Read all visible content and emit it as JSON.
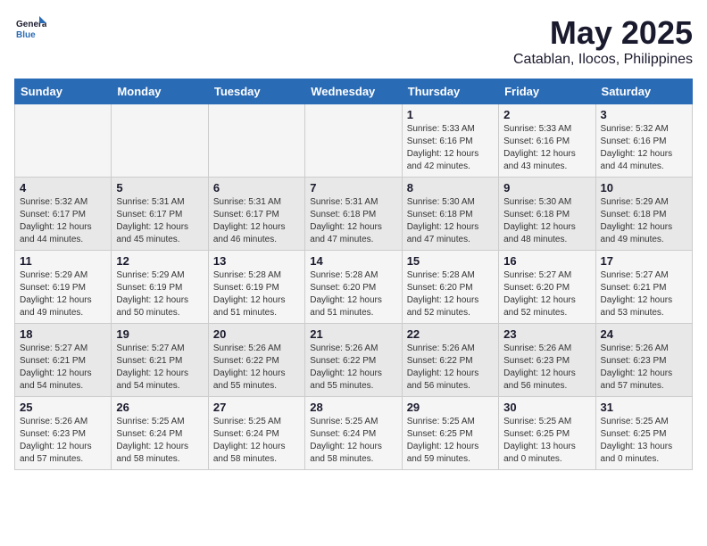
{
  "header": {
    "logo_line1": "General",
    "logo_line2": "Blue",
    "title": "May 2025",
    "subtitle": "Catablan, Ilocos, Philippines"
  },
  "calendar": {
    "days_of_week": [
      "Sunday",
      "Monday",
      "Tuesday",
      "Wednesday",
      "Thursday",
      "Friday",
      "Saturday"
    ],
    "weeks": [
      [
        {
          "day": "",
          "info": ""
        },
        {
          "day": "",
          "info": ""
        },
        {
          "day": "",
          "info": ""
        },
        {
          "day": "",
          "info": ""
        },
        {
          "day": "1",
          "info": "Sunrise: 5:33 AM\nSunset: 6:16 PM\nDaylight: 12 hours\nand 42 minutes."
        },
        {
          "day": "2",
          "info": "Sunrise: 5:33 AM\nSunset: 6:16 PM\nDaylight: 12 hours\nand 43 minutes."
        },
        {
          "day": "3",
          "info": "Sunrise: 5:32 AM\nSunset: 6:16 PM\nDaylight: 12 hours\nand 44 minutes."
        }
      ],
      [
        {
          "day": "4",
          "info": "Sunrise: 5:32 AM\nSunset: 6:17 PM\nDaylight: 12 hours\nand 44 minutes."
        },
        {
          "day": "5",
          "info": "Sunrise: 5:31 AM\nSunset: 6:17 PM\nDaylight: 12 hours\nand 45 minutes."
        },
        {
          "day": "6",
          "info": "Sunrise: 5:31 AM\nSunset: 6:17 PM\nDaylight: 12 hours\nand 46 minutes."
        },
        {
          "day": "7",
          "info": "Sunrise: 5:31 AM\nSunset: 6:18 PM\nDaylight: 12 hours\nand 47 minutes."
        },
        {
          "day": "8",
          "info": "Sunrise: 5:30 AM\nSunset: 6:18 PM\nDaylight: 12 hours\nand 47 minutes."
        },
        {
          "day": "9",
          "info": "Sunrise: 5:30 AM\nSunset: 6:18 PM\nDaylight: 12 hours\nand 48 minutes."
        },
        {
          "day": "10",
          "info": "Sunrise: 5:29 AM\nSunset: 6:18 PM\nDaylight: 12 hours\nand 49 minutes."
        }
      ],
      [
        {
          "day": "11",
          "info": "Sunrise: 5:29 AM\nSunset: 6:19 PM\nDaylight: 12 hours\nand 49 minutes."
        },
        {
          "day": "12",
          "info": "Sunrise: 5:29 AM\nSunset: 6:19 PM\nDaylight: 12 hours\nand 50 minutes."
        },
        {
          "day": "13",
          "info": "Sunrise: 5:28 AM\nSunset: 6:19 PM\nDaylight: 12 hours\nand 51 minutes."
        },
        {
          "day": "14",
          "info": "Sunrise: 5:28 AM\nSunset: 6:20 PM\nDaylight: 12 hours\nand 51 minutes."
        },
        {
          "day": "15",
          "info": "Sunrise: 5:28 AM\nSunset: 6:20 PM\nDaylight: 12 hours\nand 52 minutes."
        },
        {
          "day": "16",
          "info": "Sunrise: 5:27 AM\nSunset: 6:20 PM\nDaylight: 12 hours\nand 52 minutes."
        },
        {
          "day": "17",
          "info": "Sunrise: 5:27 AM\nSunset: 6:21 PM\nDaylight: 12 hours\nand 53 minutes."
        }
      ],
      [
        {
          "day": "18",
          "info": "Sunrise: 5:27 AM\nSunset: 6:21 PM\nDaylight: 12 hours\nand 54 minutes."
        },
        {
          "day": "19",
          "info": "Sunrise: 5:27 AM\nSunset: 6:21 PM\nDaylight: 12 hours\nand 54 minutes."
        },
        {
          "day": "20",
          "info": "Sunrise: 5:26 AM\nSunset: 6:22 PM\nDaylight: 12 hours\nand 55 minutes."
        },
        {
          "day": "21",
          "info": "Sunrise: 5:26 AM\nSunset: 6:22 PM\nDaylight: 12 hours\nand 55 minutes."
        },
        {
          "day": "22",
          "info": "Sunrise: 5:26 AM\nSunset: 6:22 PM\nDaylight: 12 hours\nand 56 minutes."
        },
        {
          "day": "23",
          "info": "Sunrise: 5:26 AM\nSunset: 6:23 PM\nDaylight: 12 hours\nand 56 minutes."
        },
        {
          "day": "24",
          "info": "Sunrise: 5:26 AM\nSunset: 6:23 PM\nDaylight: 12 hours\nand 57 minutes."
        }
      ],
      [
        {
          "day": "25",
          "info": "Sunrise: 5:26 AM\nSunset: 6:23 PM\nDaylight: 12 hours\nand 57 minutes."
        },
        {
          "day": "26",
          "info": "Sunrise: 5:25 AM\nSunset: 6:24 PM\nDaylight: 12 hours\nand 58 minutes."
        },
        {
          "day": "27",
          "info": "Sunrise: 5:25 AM\nSunset: 6:24 PM\nDaylight: 12 hours\nand 58 minutes."
        },
        {
          "day": "28",
          "info": "Sunrise: 5:25 AM\nSunset: 6:24 PM\nDaylight: 12 hours\nand 58 minutes."
        },
        {
          "day": "29",
          "info": "Sunrise: 5:25 AM\nSunset: 6:25 PM\nDaylight: 12 hours\nand 59 minutes."
        },
        {
          "day": "30",
          "info": "Sunrise: 5:25 AM\nSunset: 6:25 PM\nDaylight: 13 hours\nand 0 minutes."
        },
        {
          "day": "31",
          "info": "Sunrise: 5:25 AM\nSunset: 6:25 PM\nDaylight: 13 hours\nand 0 minutes."
        }
      ]
    ]
  }
}
